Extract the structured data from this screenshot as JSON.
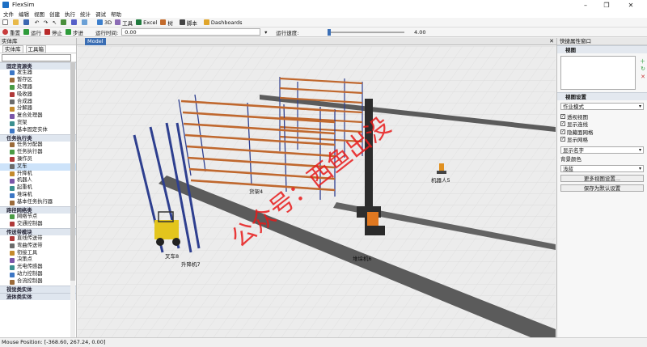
{
  "window": {
    "title": "FlexSim"
  },
  "menu": [
    "文件",
    "编辑",
    "视图",
    "创建",
    "执行",
    "统计",
    "调试",
    "帮助"
  ],
  "toolbar": {
    "btn_3d": "3D",
    "btn_tools": "工具",
    "btn_excel": "Excel",
    "btn_tree": "树",
    "btn_script": "脚本",
    "btn_dashboards": "Dashboards"
  },
  "runbar": {
    "reset": "重置",
    "run": "运行",
    "stop": "停止",
    "step": "步进",
    "time_label": "运行时间:",
    "time_value": "0.00",
    "speed_label": "运行速度:",
    "speed_value": "4.00"
  },
  "library": {
    "title": "实体库",
    "tabs": [
      "实体库",
      "工具箱"
    ],
    "sections": [
      {
        "name": "固定资源类",
        "items": [
          "发生器",
          "暂存区",
          "处理器",
          "吸收器",
          "合成器",
          "分解器",
          "复合处理器",
          "货架",
          "基本固定实体"
        ]
      },
      {
        "name": "任务执行类",
        "items": [
          "任务分配器",
          "任务执行器",
          "操作员",
          "叉车",
          "升降机",
          "机器人",
          "起重机",
          "堆垛机",
          "基本任务执行器"
        ]
      },
      {
        "name": "路径网络类",
        "items": [
          "网络节点",
          "交通控制器"
        ]
      },
      {
        "name": "传送带模块",
        "items": [
          "直线传送带",
          "弯曲传送带",
          "衔接工具",
          "决策点",
          "光电传感器",
          "动力控制器",
          "合流控制器"
        ]
      },
      {
        "name": "视觉类实体",
        "items": []
      },
      {
        "name": "流体类实体",
        "items": []
      }
    ],
    "selected": "叉车"
  },
  "model_tab": "Model",
  "scene_labels": {
    "rack": "货架4",
    "robot": "机器人5",
    "asrs": "堆垛机6",
    "forklift": "叉车8",
    "elevator": "升降机7"
  },
  "watermark": "公众号：西鱼出没",
  "properties": {
    "title": "快捷属性窗口",
    "sec_view": "视图",
    "sec_settings": "视图设置",
    "mode": "作业模式",
    "checks": [
      {
        "label": "透视视图",
        "checked": true
      },
      {
        "label": "显示连线",
        "checked": true
      },
      {
        "label": "隐藏面网格",
        "checked": true
      },
      {
        "label": "显示网格",
        "checked": true
      }
    ],
    "display_label": "显示名字",
    "bg_label": "背景颜色",
    "bg_value": "浅蓝",
    "btn_more": "更多视图设置...",
    "btn_save": "保存为默认设置"
  },
  "status": {
    "mouse": "Mouse Position: [-368.60, 267.24, 0.00]"
  },
  "colors": {
    "accent": "#3a6db3",
    "rack_frame": "#2e3f8f",
    "rack_shelf": "#c0682e",
    "track": "#595959"
  }
}
